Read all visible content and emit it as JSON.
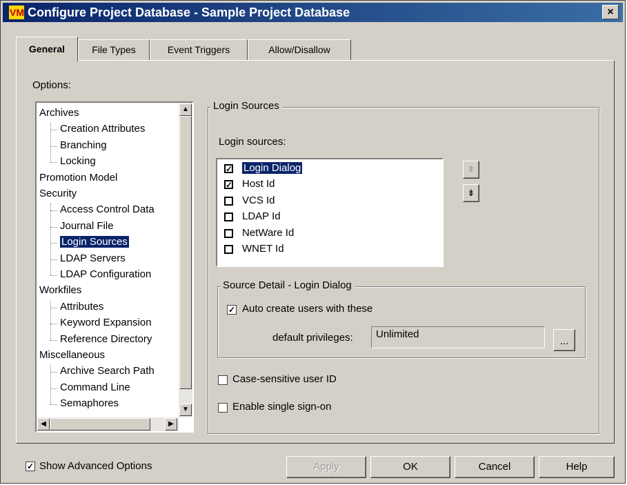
{
  "window": {
    "title": "Configure Project Database - Sample Project Database",
    "close_glyph": "×",
    "app_icon": "vm-app-icon"
  },
  "tabs": [
    {
      "label": "General",
      "active": true
    },
    {
      "label": "File Types",
      "active": false
    },
    {
      "label": "Event Triggers",
      "active": false
    },
    {
      "label": "Allow/Disallow",
      "active": false
    }
  ],
  "options_label": "Options:",
  "tree": {
    "items": [
      {
        "label": "Archives",
        "level": 0
      },
      {
        "label": "Creation Attributes",
        "level": 1
      },
      {
        "label": "Branching",
        "level": 1
      },
      {
        "label": "Locking",
        "level": 1
      },
      {
        "label": "Promotion Model",
        "level": 0
      },
      {
        "label": "Security",
        "level": 0
      },
      {
        "label": "Access Control Data",
        "level": 1
      },
      {
        "label": "Journal File",
        "level": 1
      },
      {
        "label": "Login Sources",
        "level": 1,
        "selected": true
      },
      {
        "label": "LDAP Servers",
        "level": 1
      },
      {
        "label": "LDAP Configuration",
        "level": 1
      },
      {
        "label": "Workfiles",
        "level": 0
      },
      {
        "label": "Attributes",
        "level": 1
      },
      {
        "label": "Keyword Expansion",
        "level": 1
      },
      {
        "label": "Reference Directory",
        "level": 1
      },
      {
        "label": "Miscellaneous",
        "level": 0
      },
      {
        "label": "Archive Search Path",
        "level": 1
      },
      {
        "label": "Command Line",
        "level": 1
      },
      {
        "label": "Semaphores",
        "level": 1
      }
    ]
  },
  "login_sources_group": {
    "title": "Login Sources",
    "list_label": "Login sources:",
    "items": [
      {
        "label": "Login Dialog",
        "checked": true,
        "selected": true
      },
      {
        "label": "Host Id",
        "checked": true
      },
      {
        "label": "VCS Id",
        "checked": false
      },
      {
        "label": "LDAP Id",
        "checked": false
      },
      {
        "label": "NetWare Id",
        "checked": false
      },
      {
        "label": "WNET Id",
        "checked": false
      }
    ],
    "move_up_icon": "move-up-icon",
    "move_down_icon": "move-down-icon"
  },
  "source_detail": {
    "title": "Source Detail - Login Dialog",
    "auto_create_label": "Auto create users with these",
    "auto_create_checked": true,
    "default_privileges_label": "default privileges:",
    "default_privileges_value": "Unlimited",
    "browse_label": "..."
  },
  "options": {
    "case_sensitive_label": "Case-sensitive user ID",
    "case_sensitive_checked": false,
    "single_sign_on_label": "Enable single sign-on",
    "single_sign_on_checked": false
  },
  "footer": {
    "show_advanced_label": "Show Advanced Options",
    "show_advanced_checked": true,
    "apply_label": "Apply",
    "ok_label": "OK",
    "cancel_label": "Cancel",
    "help_label": "Help"
  }
}
